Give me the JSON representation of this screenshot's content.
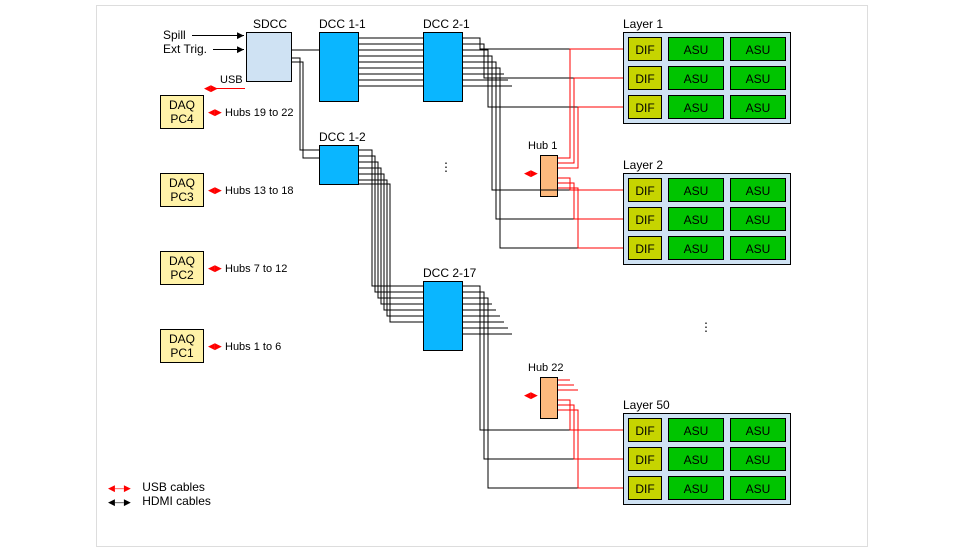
{
  "inputs": {
    "spill": "Spill",
    "ext_trig": "Ext Trig.",
    "usb": "USB"
  },
  "sdcc": {
    "label": "SDCC"
  },
  "dcc1": {
    "a": "DCC 1-1",
    "b": "DCC 1-2"
  },
  "dcc2": {
    "a": "DCC 2-1",
    "b": "DCC 2-17"
  },
  "daq": {
    "pc4": {
      "name": "DAQ",
      "sub": "PC4",
      "hubs": "Hubs 19 to 22"
    },
    "pc3": {
      "name": "DAQ",
      "sub": "PC3",
      "hubs": "Hubs 13 to 18"
    },
    "pc2": {
      "name": "DAQ",
      "sub": "PC2",
      "hubs": "Hubs 7 to 12"
    },
    "pc1": {
      "name": "DAQ",
      "sub": "PC1",
      "hubs": "Hubs 1 to 6"
    }
  },
  "hubs": {
    "h1": "Hub 1",
    "h22": "Hub 22"
  },
  "layers": {
    "l1": "Layer 1",
    "l2": "Layer 2",
    "l50": "Layer 50"
  },
  "cells": {
    "dif": "DIF",
    "asu": "ASU"
  },
  "legend": {
    "usb": "USB cables",
    "hdmi": "HDMI cables"
  },
  "chart_data": {
    "type": "table",
    "title": "DAQ readout architecture",
    "nodes": {
      "inputs": [
        "Spill",
        "Ext Trig.",
        "USB"
      ],
      "SDCC": 1,
      "DCC_level1": [
        "DCC 1-1",
        "DCC 1-2"
      ],
      "DCC_level2": [
        "DCC 2-1",
        "…",
        "DCC 2-17"
      ],
      "DAQ_PCs": [
        {
          "id": "PC1",
          "hubs": "1–6"
        },
        {
          "id": "PC2",
          "hubs": "7–12"
        },
        {
          "id": "PC3",
          "hubs": "13–18"
        },
        {
          "id": "PC4",
          "hubs": "19–22"
        }
      ],
      "Hubs": [
        "Hub 1",
        "…",
        "Hub 22"
      ],
      "Layers": [
        "Layer 1",
        "Layer 2",
        "…",
        "Layer 50"
      ],
      "per_layer": {
        "DIF": 3,
        "ASU_per_DIF": 2
      }
    },
    "cable_types": {
      "USB": {
        "color": "red",
        "endpoints": [
          "DAQ PC ↔ Hubs",
          "Hub ↔ DIF slot",
          "SDCC ↔ DAQ"
        ]
      },
      "HDMI": {
        "color": "black",
        "endpoints": [
          "Spill/Ext Trig → SDCC",
          "SDCC → DCC1",
          "DCC1 → DCC2",
          "DCC2 → DIF"
        ]
      }
    },
    "fanout": {
      "SDCC_to_DCC1": 2,
      "DCC1_to_DCC2_total": 17,
      "DCC2_to_DIF_per_unit": "many (≈9 lines drawn)",
      "Hubs_total": 22,
      "Layers_total": 50
    }
  }
}
